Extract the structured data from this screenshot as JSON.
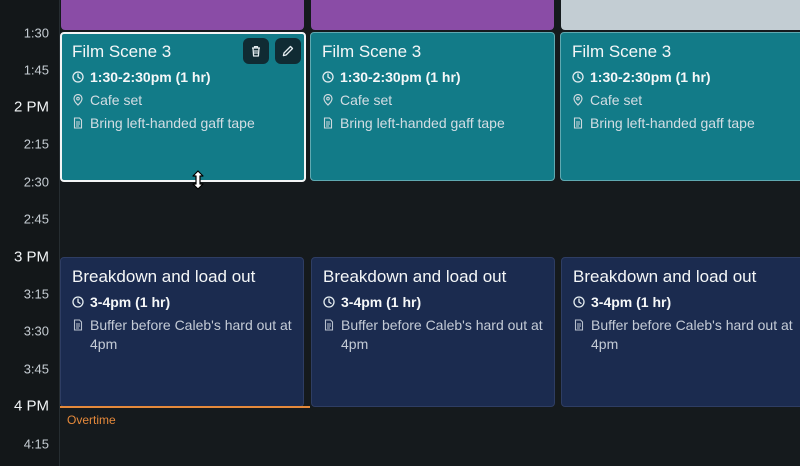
{
  "timeline": {
    "labels": [
      {
        "text": "1:30",
        "hour": false
      },
      {
        "text": "1:45",
        "hour": false
      },
      {
        "text": "2 PM",
        "hour": true
      },
      {
        "text": "2:15",
        "hour": false
      },
      {
        "text": "2:30",
        "hour": false
      },
      {
        "text": "2:45",
        "hour": false
      },
      {
        "text": "3 PM",
        "hour": true
      },
      {
        "text": "3:15",
        "hour": false
      },
      {
        "text": "3:30",
        "hour": false
      },
      {
        "text": "3:45",
        "hour": false
      },
      {
        "text": "4 PM",
        "hour": true
      },
      {
        "text": "4:15",
        "hour": false
      }
    ]
  },
  "colors": {
    "film_event": "#127b88",
    "breakdown_event": "#1b2b4f",
    "overtime": "#e5893b",
    "top_event_purple": "#8a4ca6",
    "top_event_gray": "#c3cdd3"
  },
  "columns": [
    {
      "film": {
        "title": "Film Scene 3",
        "time": "1:30-2:30pm (1 hr)",
        "location": "Cafe set",
        "note": "Bring left-handed gaff tape"
      },
      "breakdown": {
        "title": "Breakdown and load out",
        "time": "3-4pm (1 hr)",
        "note": "Buffer before Caleb's hard out at 4pm"
      }
    },
    {
      "film": {
        "title": "Film Scene 3",
        "time": "1:30-2:30pm (1 hr)",
        "location": "Cafe set",
        "note": "Bring left-handed gaff tape"
      },
      "breakdown": {
        "title": "Breakdown and load out",
        "time": "3-4pm (1 hr)",
        "note": "Buffer before Caleb's hard out at 4pm"
      }
    },
    {
      "film": {
        "title": "Film Scene 3",
        "time": "1:30-2:30pm (1 hr)",
        "location": "Cafe set",
        "note": "Bring left-handed gaff tape"
      },
      "breakdown": {
        "title": "Breakdown and load out",
        "time": "3-4pm (1 hr)",
        "note": "Buffer before Caleb's hard out at 4pm"
      }
    }
  ],
  "icons": {
    "delete": "trash-icon",
    "edit": "pencil-icon",
    "time": "clock-icon",
    "location": "map-pin-icon",
    "note": "note-icon",
    "resize": "resize-vertical-icon"
  },
  "overtime": {
    "label": "Overtime"
  }
}
